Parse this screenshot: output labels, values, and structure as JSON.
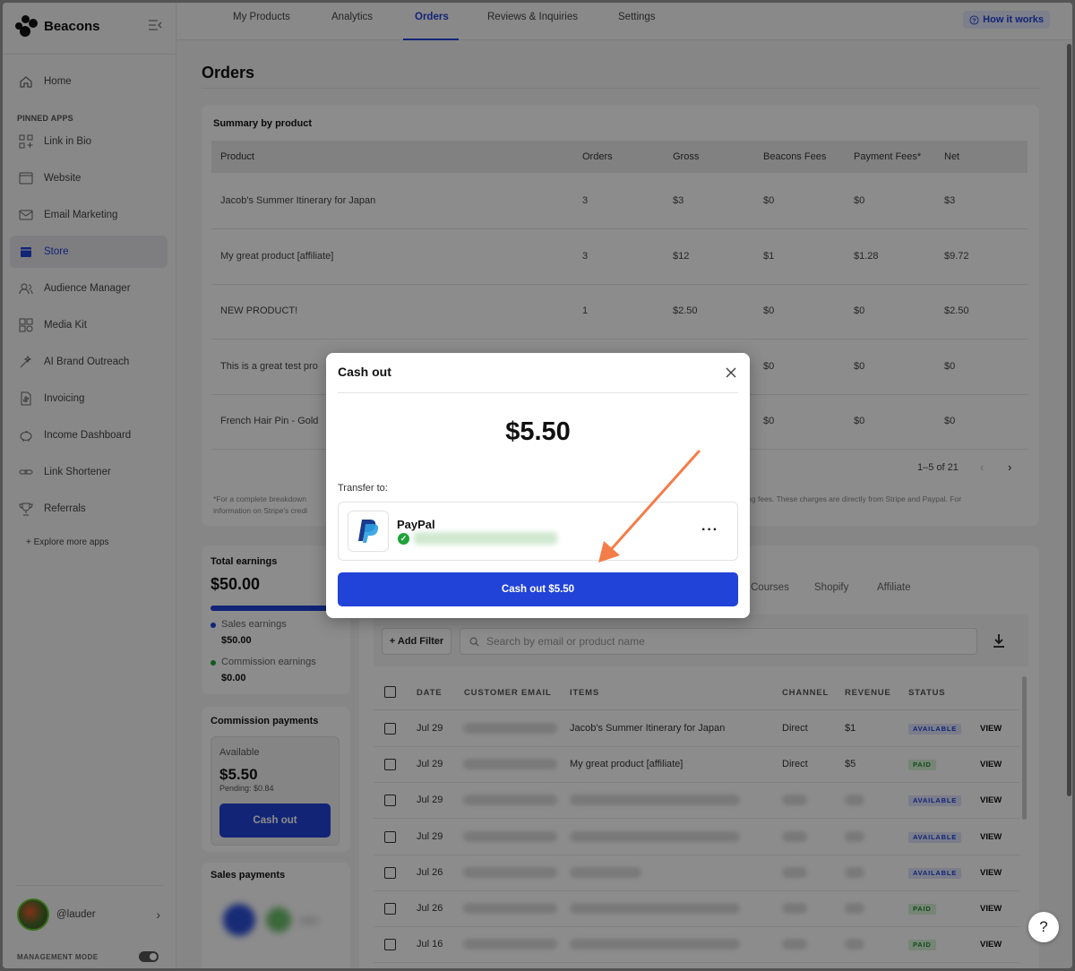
{
  "sidebar": {
    "brand": "Beacons",
    "pinned_label": "PINNED APPS",
    "items": [
      {
        "label": "Home",
        "icon": "home-icon"
      },
      {
        "label": "Link in Bio",
        "icon": "grid-icon"
      },
      {
        "label": "Website",
        "icon": "browser-icon"
      },
      {
        "label": "Email Marketing",
        "icon": "mail-icon"
      },
      {
        "label": "Store",
        "icon": "store-icon",
        "active": true
      },
      {
        "label": "Audience Manager",
        "icon": "people-icon"
      },
      {
        "label": "Media Kit",
        "icon": "mediakit-icon"
      },
      {
        "label": "AI Brand Outreach",
        "icon": "wand-icon"
      },
      {
        "label": "Invoicing",
        "icon": "invoice-icon"
      },
      {
        "label": "Income Dashboard",
        "icon": "piggy-icon"
      },
      {
        "label": "Link Shortener",
        "icon": "link-icon"
      },
      {
        "label": "Referrals",
        "icon": "trophy-icon"
      }
    ],
    "explore": "+ Explore more apps",
    "username": "@lauder",
    "management_mode": "MANAGEMENT MODE"
  },
  "topnav": {
    "tabs": [
      "My Products",
      "Analytics",
      "Orders",
      "Reviews & Inquiries",
      "Settings"
    ],
    "active_tab": "Orders",
    "how_it_works": "How it works"
  },
  "page_title": "Orders",
  "summary": {
    "title": "Summary by product",
    "headers": [
      "Product",
      "Orders",
      "Gross",
      "Beacons Fees",
      "Payment Fees*",
      "Net"
    ],
    "rows": [
      [
        "Jacob's Summer Itinerary for Japan",
        "3",
        "$3",
        "$0",
        "$0",
        "$3"
      ],
      [
        "My great product [affiliate]",
        "3",
        "$12",
        "$1",
        "$1.28",
        "$9.72"
      ],
      [
        "NEW PRODUCT!",
        "1",
        "$2.50",
        "$0",
        "$0",
        "$2.50"
      ],
      [
        "This is a great test pro",
        "",
        "",
        "$0",
        "$0",
        "$0"
      ],
      [
        "French Hair Pin - Gold",
        "",
        "",
        "$0",
        "$0",
        "$0"
      ]
    ],
    "pagination": "1–5 of 21",
    "footnote_left": "*For a complete breakdown",
    "footnote_left2": "information on Stripe's credi",
    "footnote_right": "sing fees. These charges are directly from Stripe and Paypal. For"
  },
  "earnings": {
    "title": "Total earnings",
    "amount": "$50.00",
    "sales_label": "Sales earnings",
    "sales_value": "$50.00",
    "commission_label": "Commission earnings",
    "commission_value": "$0.00",
    "sales_fraction": 1.0,
    "colors": {
      "sales": "#2243d8",
      "commission": "#1fa23a"
    }
  },
  "commission": {
    "title": "Commission payments",
    "available_label": "Available",
    "available_amount": "$5.50",
    "pending": "Pending: $0.84",
    "cashout_label": "Cash out"
  },
  "sales_payments": {
    "title": "Sales payments"
  },
  "orders": {
    "tabs": [
      "Courses",
      "Shopify",
      "Affiliate"
    ],
    "add_filter": "+ Add Filter",
    "search_placeholder": "Search by email or product name",
    "headers": [
      "DATE",
      "CUSTOMER EMAIL",
      "ITEMS",
      "CHANNEL",
      "REVENUE",
      "STATUS"
    ],
    "view_label": "VIEW",
    "rows": [
      {
        "date": "Jul 29",
        "item": "Jacob's Summer Itinerary for Japan",
        "channel": "Direct",
        "revenue": "$1",
        "status": "AVAILABLE"
      },
      {
        "date": "Jul 29",
        "item": "My great product [affiliate]",
        "channel": "Direct",
        "revenue": "$5",
        "status": "PAID"
      },
      {
        "date": "Jul 29",
        "item": "",
        "channel": "",
        "revenue": "",
        "status": "AVAILABLE"
      },
      {
        "date": "Jul 29",
        "item": "",
        "channel": "",
        "revenue": "",
        "status": "AVAILABLE"
      },
      {
        "date": "Jul 26",
        "item": "",
        "channel": "",
        "revenue": "",
        "status": "AVAILABLE"
      },
      {
        "date": "Jul 26",
        "item": "",
        "channel": "",
        "revenue": "",
        "status": "PAID"
      },
      {
        "date": "Jul 16",
        "item": "",
        "channel": "",
        "revenue": "",
        "status": "PAID"
      }
    ]
  },
  "modal": {
    "title": "Cash out",
    "amount": "$5.50",
    "transfer_label": "Transfer to:",
    "method_name": "PayPal",
    "more_label": "···",
    "cashout_button": "Cash out $5.50"
  },
  "help_label": "?",
  "accent_color": "#2243d8",
  "annotation_arrow_color": "#f47c48"
}
